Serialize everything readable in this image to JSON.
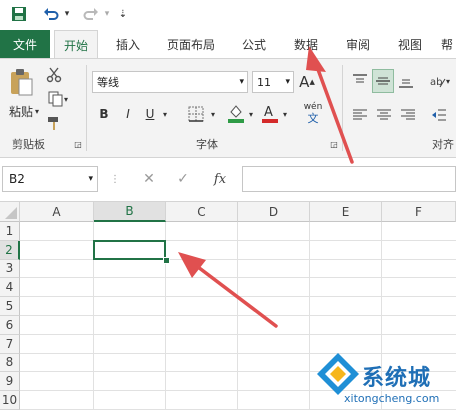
{
  "qat": {
    "save_icon": "save-icon",
    "undo_icon": "undo-icon",
    "redo_icon": "redo-icon",
    "customize_icon": "customize-icon"
  },
  "tabs": {
    "file": "文件",
    "items": [
      "开始",
      "插入",
      "页面布局",
      "公式",
      "数据",
      "审阅",
      "视图",
      "帮"
    ]
  },
  "ribbon": {
    "clipboard": {
      "paste": "粘贴",
      "group_label": "剪贴板"
    },
    "font": {
      "font_name": "等线",
      "font_size": "11",
      "bold": "B",
      "italic": "I",
      "underline": "U",
      "wen": "wén",
      "wen_char": "文",
      "group_label": "字体"
    },
    "align": {
      "group_label": "对齐"
    }
  },
  "formula_bar": {
    "name_box": "B2",
    "fx": "fx"
  },
  "grid": {
    "columns": [
      "A",
      "B",
      "C",
      "D",
      "E",
      "F"
    ],
    "rows": [
      "1",
      "2",
      "3",
      "4",
      "5",
      "6",
      "7",
      "8",
      "9",
      "10"
    ],
    "selected_col": "B",
    "selected_row": "2"
  },
  "watermark": {
    "brand": "系统城",
    "url": "xitongcheng.com"
  },
  "colors": {
    "accent": "#217346",
    "arrow": "#e05050"
  }
}
